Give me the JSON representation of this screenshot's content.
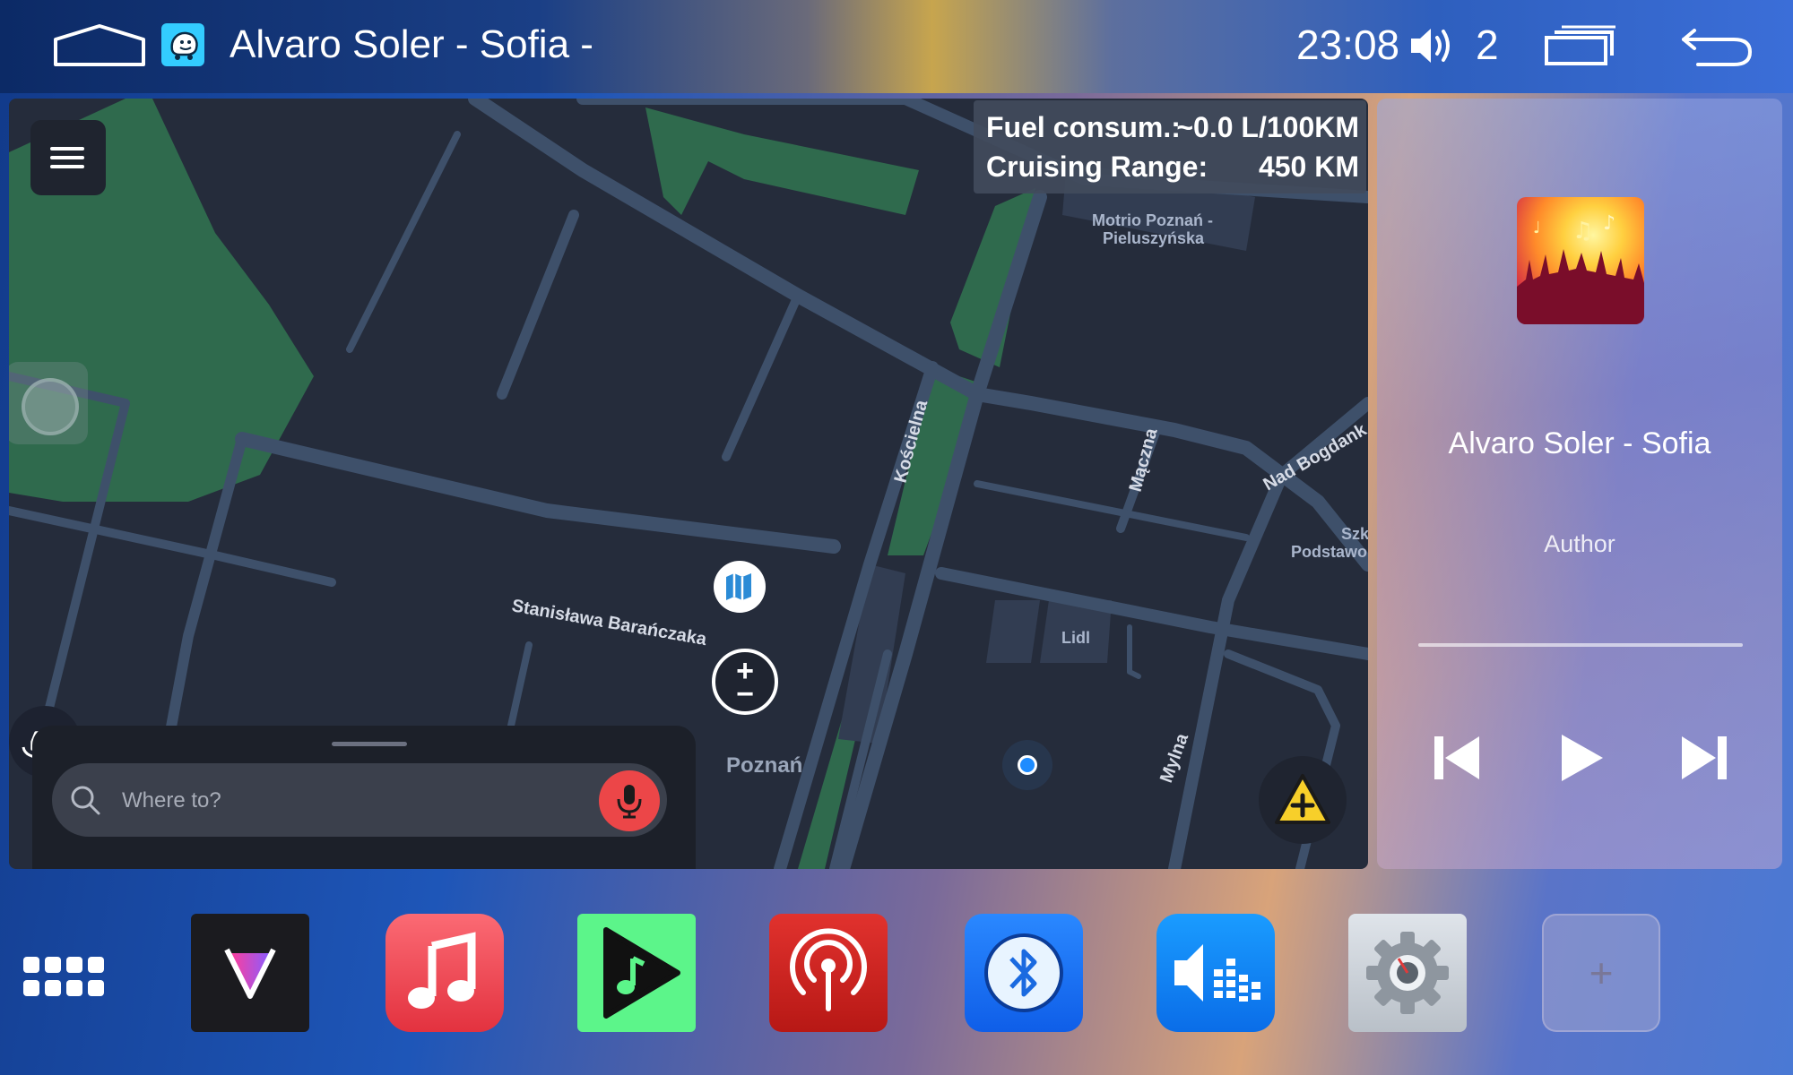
{
  "status_bar": {
    "media_title": "Alvaro Soler - Sofia -",
    "time": "23:08",
    "volume_level": "2",
    "icons": [
      "home-icon",
      "waze-icon",
      "volume-icon",
      "recent-apps-icon",
      "back-icon"
    ]
  },
  "map": {
    "fuel": {
      "label": "Fuel consum.:",
      "value": "~0.0 L/100KM"
    },
    "range": {
      "label": "Cruising Range:",
      "value": "450 KM"
    },
    "street_labels": {
      "koscielna": "Kościelna",
      "maczna": "Mączna",
      "nad_bogdanka": "Nad Bogdank",
      "baranczaka": "Stanisława Barańczaka",
      "mylna": "Mylna"
    },
    "poi_labels": {
      "motrio_line1": "Motrio Poznań -",
      "motrio_line2": "Pieluszyńska",
      "lidl": "Lidl",
      "szk_line1": "Szk",
      "szk_line2": "Podstawo"
    },
    "city_label": "Poznań",
    "zoom_plus": "+",
    "zoom_minus": "−",
    "search_placeholder": "Where to?",
    "colors": {
      "background": "#252c3b",
      "road": "#3e506a",
      "park": "#2f6a4d",
      "report": "#f7cf2a",
      "mic": "#ec4648"
    }
  },
  "media": {
    "title": "Alvaro Soler - Sofia",
    "author": "Author",
    "progress": 0.0,
    "controls": [
      "previous-track-icon",
      "play-icon",
      "next-track-icon"
    ]
  },
  "dock": {
    "apps": [
      "apps-grid",
      "v-app",
      "music-app",
      "music-player-app",
      "radio-app",
      "bluetooth-app",
      "equalizer-app",
      "settings-app",
      "add-app"
    ],
    "add_label": "+"
  }
}
